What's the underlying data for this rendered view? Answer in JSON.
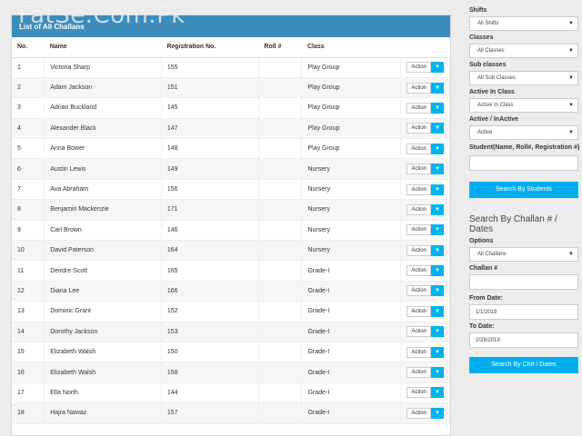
{
  "watermark": "FatSe.Com.Pk",
  "panel": {
    "title": "List of All Challans"
  },
  "table": {
    "headers": [
      "No.",
      "Name",
      "Registration No.",
      "Roll #",
      "Class",
      ""
    ],
    "action_label": "Action",
    "rows": [
      {
        "no": "1",
        "name": "Victoria Sharp",
        "reg": "155",
        "roll": "",
        "cls": "Play Group"
      },
      {
        "no": "2",
        "name": "Adam Jackson",
        "reg": "151",
        "roll": "",
        "cls": "Play Group"
      },
      {
        "no": "3",
        "name": "Adrian Buckland",
        "reg": "145",
        "roll": "",
        "cls": "Play Group"
      },
      {
        "no": "4",
        "name": "Alexander Black",
        "reg": "147",
        "roll": "",
        "cls": "Play Group"
      },
      {
        "no": "5",
        "name": "Anna Bower",
        "reg": "148",
        "roll": "",
        "cls": "Play Group"
      },
      {
        "no": "6",
        "name": "Austin Lewis",
        "reg": "149",
        "roll": "",
        "cls": "Nursery"
      },
      {
        "no": "7",
        "name": "Ava Abraham",
        "reg": "156",
        "roll": "",
        "cls": "Nursery"
      },
      {
        "no": "8",
        "name": "Benjamin Mackenzie",
        "reg": "171",
        "roll": "",
        "cls": "Nursery"
      },
      {
        "no": "9",
        "name": "Carl Brown",
        "reg": "146",
        "roll": "",
        "cls": "Nursery"
      },
      {
        "no": "10",
        "name": "David Paterson",
        "reg": "164",
        "roll": "",
        "cls": "Nursery"
      },
      {
        "no": "11",
        "name": "Deirdre Scott",
        "reg": "165",
        "roll": "",
        "cls": "Grade-I"
      },
      {
        "no": "12",
        "name": "Diana Lee",
        "reg": "166",
        "roll": "",
        "cls": "Grade-I"
      },
      {
        "no": "13",
        "name": "Dominic Grant",
        "reg": "152",
        "roll": "",
        "cls": "Grade-I"
      },
      {
        "no": "14",
        "name": "Dorothy Jackson",
        "reg": "153",
        "roll": "",
        "cls": "Grade-I"
      },
      {
        "no": "15",
        "name": "Elizabeth Walsh",
        "reg": "150",
        "roll": "",
        "cls": "Grade-I"
      },
      {
        "no": "16",
        "name": "Elizabeth Walsh",
        "reg": "158",
        "roll": "",
        "cls": "Grade-I"
      },
      {
        "no": "17",
        "name": "Ella North",
        "reg": "144",
        "roll": "",
        "cls": "Grade-I"
      },
      {
        "no": "18",
        "name": "Hajra Nawaz",
        "reg": "157",
        "roll": "",
        "cls": "Grade-I"
      }
    ]
  },
  "filters": {
    "shifts_label": "Shifts",
    "shifts_value": "All Shifts",
    "classes_label": "Classes",
    "classes_value": "All Classes",
    "subclasses_label": "Sub classes",
    "subclasses_value": "All Sub Classes",
    "active_in_class_label": "Active In Class",
    "active_in_class_value": "Active In Class",
    "active_inactive_label": "Active / InActive",
    "active_inactive_value": "Active",
    "student_label": "Student(Name, Roll#, Registration #)",
    "student_value": "",
    "search_students_button": "Search By Students"
  },
  "challan_search": {
    "title": "Search By Challan # / Dates",
    "options_label": "Options",
    "options_value": "All Challans",
    "challan_label": "Challan #",
    "challan_value": "",
    "from_label": "From Date:",
    "from_value": "1/1/2019",
    "to_label": "To Date:",
    "to_value": "2/28/2019",
    "search_button": "Search By Ch# / Dates"
  },
  "colors": {
    "panel_header": "#3c8dbc",
    "accent_button": "#00aeef"
  }
}
